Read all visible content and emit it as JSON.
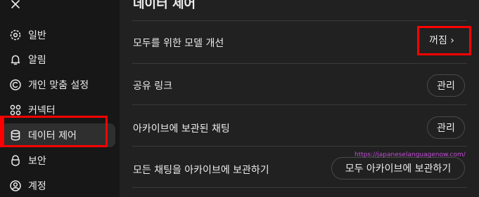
{
  "sidebar": {
    "items": [
      {
        "label": "일반",
        "icon": "gear-icon"
      },
      {
        "label": "알림",
        "icon": "bell-icon"
      },
      {
        "label": "개인 맞춤 설정",
        "icon": "personalize-icon"
      },
      {
        "label": "커넥터",
        "icon": "connector-icon"
      },
      {
        "label": "데이터 제어",
        "icon": "database-icon"
      },
      {
        "label": "보안",
        "icon": "lock-icon"
      },
      {
        "label": "계정",
        "icon": "account-icon"
      }
    ]
  },
  "main": {
    "title": "데이터 제어",
    "rows": [
      {
        "label": "모두를 위한 모델 개선",
        "action": "꺼짐 ›"
      },
      {
        "label": "공유 링크",
        "action": "관리"
      },
      {
        "label": "아카이브에 보관된 채팅",
        "action": "관리"
      },
      {
        "label": "모든 채팅을 아카이브에 보관하기",
        "action": "모두 아카이브에 보관하기"
      }
    ]
  },
  "watermark": "https://japaneselanguagenow.com/",
  "colors": {
    "highlight": "#ff0000",
    "background": "#212121",
    "sidebar": "#171717",
    "watermark": "#c44bd8"
  }
}
